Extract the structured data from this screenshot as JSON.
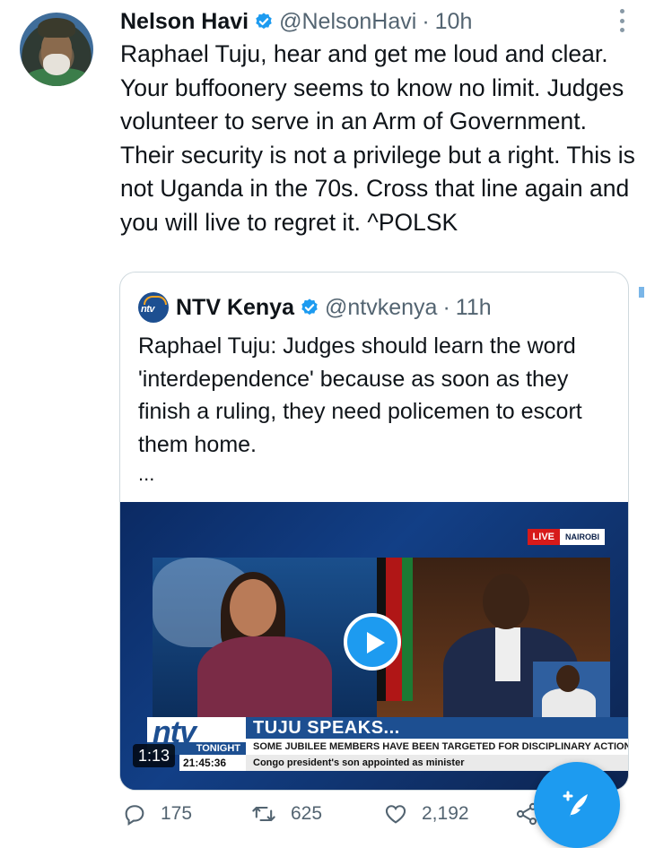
{
  "tweet": {
    "author_name": "Nelson Havi",
    "author_handle": "@NelsonHavi",
    "separator": "·",
    "time": "10h",
    "text": "Raphael Tuju, hear and get me loud and clear. Your buffoonery seems to know no limit. Judges volunteer to serve in an Arm of Government. Their security is not a privilege but a right. This is not Uganda in the 70s. Cross that line again and you will live to regret it. ^POLSK"
  },
  "quoted": {
    "author_name": "NTV Kenya",
    "author_handle": "@ntvkenya",
    "separator": "·",
    "time": "11h",
    "text": "Raphael Tuju: Judges should learn the word 'interdependence' because as soon as they finish a ruling, they need policemen to escort them home.",
    "ellipsis": "...",
    "logo_text": "ntv",
    "video": {
      "live_label": "LIVE",
      "location_label": "NAIROBI",
      "brand": "ntv",
      "brand_sub": "TONIGHT",
      "headline": "TUJU SPEAKS...",
      "subheadline": "SOME JUBILEE MEMBERS HAVE BEEN TARGETED FOR DISCIPLINARY ACTION",
      "clock": "21:45:36",
      "ticker": "Congo president's son appointed as minister",
      "duration": "1:13"
    }
  },
  "actions": {
    "replies": "175",
    "retweets": "625",
    "likes": "2,192"
  },
  "colors": {
    "accent": "#1d9bf0",
    "muted": "#536471",
    "ntv_blue": "#1d4f91"
  },
  "icons": [
    "more-icon",
    "verified-icon",
    "reply-icon",
    "retweet-icon",
    "like-icon",
    "share-icon",
    "play-icon",
    "compose-icon"
  ]
}
